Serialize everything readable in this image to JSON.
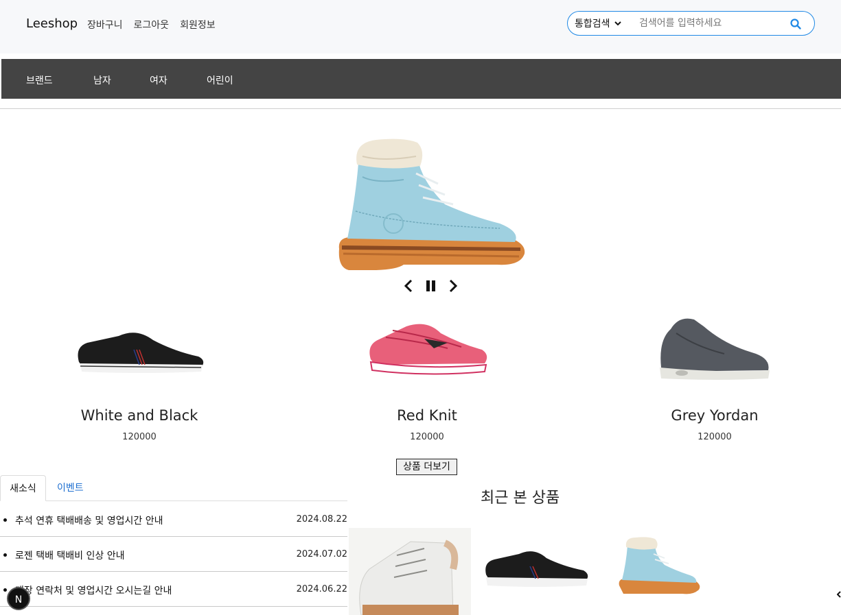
{
  "header": {
    "logo": "Leeshop",
    "links": [
      "장바구니",
      "로그아웃",
      "회원정보"
    ],
    "search": {
      "category": "통합검색",
      "placeholder": "검색어를 입력하세요",
      "icon": "search-icon"
    }
  },
  "nav": {
    "items": [
      "브랜드",
      "남자",
      "여자",
      "어린이"
    ]
  },
  "carousel": {
    "controls": [
      "chevron-left-icon",
      "pause-icon",
      "chevron-right-icon"
    ]
  },
  "products": [
    {
      "name": "White and Black",
      "price": "120000"
    },
    {
      "name": "Red Knit",
      "price": "120000"
    },
    {
      "name": "Grey Yordan",
      "price": "120000"
    }
  ],
  "more_button": "상품 더보기",
  "tabs": {
    "active": "새소식",
    "inactive": "이벤트"
  },
  "news": [
    {
      "title": "추석 연휴 택배배송 및 영업시간 안내",
      "date": "2024.08.22"
    },
    {
      "title": "로젠 택배 택배비 인상 안내",
      "date": "2024.07.02"
    },
    {
      "title": "매장 연락처 및 영업시간 오시는길 안내",
      "date": "2024.06.22"
    }
  ],
  "recent": {
    "title": "최근 본 상품"
  },
  "badge": "N",
  "colors": {
    "accent": "#1e88e5",
    "nav_bg": "#444444",
    "header_bg": "#f7f8fa"
  }
}
